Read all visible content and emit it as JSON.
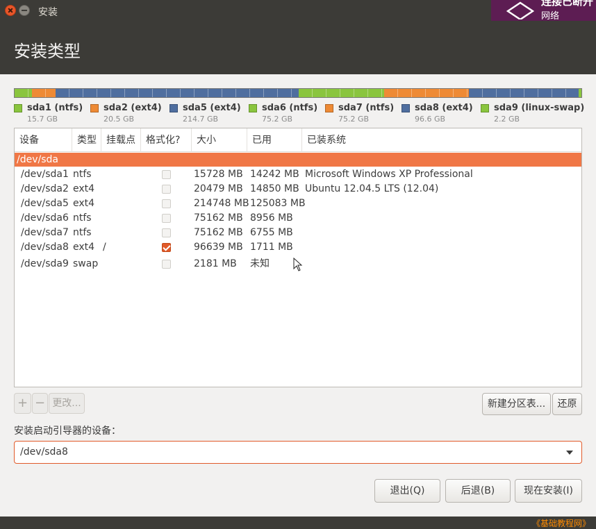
{
  "window": {
    "title": "安装"
  },
  "notification": {
    "title": "连接已断开",
    "subtitle": "网络"
  },
  "header": {
    "title": "安装类型"
  },
  "partitions": [
    {
      "name": "sda1 (ntfs)",
      "size": "15.7 GB",
      "color": "#8ac53e"
    },
    {
      "name": "sda2 (ext4)",
      "size": "20.5 GB",
      "color": "#ee8a35"
    },
    {
      "name": "sda5 (ext4)",
      "size": "214.7 GB",
      "color": "#4f6e9f"
    },
    {
      "name": "sda6 (ntfs)",
      "size": "75.2 GB",
      "color": "#8ac53e"
    },
    {
      "name": "sda7 (ntfs)",
      "size": "75.2 GB",
      "color": "#ee8a35"
    },
    {
      "name": "sda8 (ext4)",
      "size": "96.6 GB",
      "color": "#4f6e9f"
    },
    {
      "name": "sda9 (linux-swap)",
      "size": "2.2 GB",
      "color": "#8ac53e"
    }
  ],
  "table": {
    "headers": [
      "设备",
      "类型",
      "挂载点",
      "格式化?",
      "大小",
      "已用",
      "已装系统"
    ],
    "disk": "/dev/sda",
    "rows": [
      {
        "device": "/dev/sda1",
        "type": "ntfs",
        "mount": "",
        "format": false,
        "size": "15728 MB",
        "used": "14242 MB",
        "system": "Microsoft Windows XP Professional"
      },
      {
        "device": "/dev/sda2",
        "type": "ext4",
        "mount": "",
        "format": false,
        "size": "20479 MB",
        "used": "14850 MB",
        "system": "Ubuntu 12.04.5 LTS (12.04)"
      },
      {
        "device": "/dev/sda5",
        "type": "ext4",
        "mount": "",
        "format": false,
        "size": "214748 MB",
        "used": "125083 MB",
        "system": ""
      },
      {
        "device": "/dev/sda6",
        "type": "ntfs",
        "mount": "",
        "format": false,
        "size": "75162 MB",
        "used": "8956 MB",
        "system": ""
      },
      {
        "device": "/dev/sda7",
        "type": "ntfs",
        "mount": "",
        "format": false,
        "size": "75162 MB",
        "used": "6755 MB",
        "system": ""
      },
      {
        "device": "/dev/sda8",
        "type": "ext4",
        "mount": "/",
        "format": true,
        "size": "96639 MB",
        "used": "1711 MB",
        "system": ""
      },
      {
        "device": "/dev/sda9",
        "type": "swap",
        "mount": "",
        "format": false,
        "size": "2181 MB",
        "used": "未知",
        "system": ""
      }
    ]
  },
  "table_buttons": {
    "add": "+",
    "remove": "−",
    "change": "更改...",
    "new_table": "新建分区表...",
    "revert": "还原"
  },
  "bootloader": {
    "label": "安装启动引导器的设备：",
    "value": "/dev/sda8"
  },
  "actions": {
    "quit": "退出(Q)",
    "back": "后退(B)",
    "install_now": "现在安装(I)"
  },
  "watermark": "《基础教程网》"
}
